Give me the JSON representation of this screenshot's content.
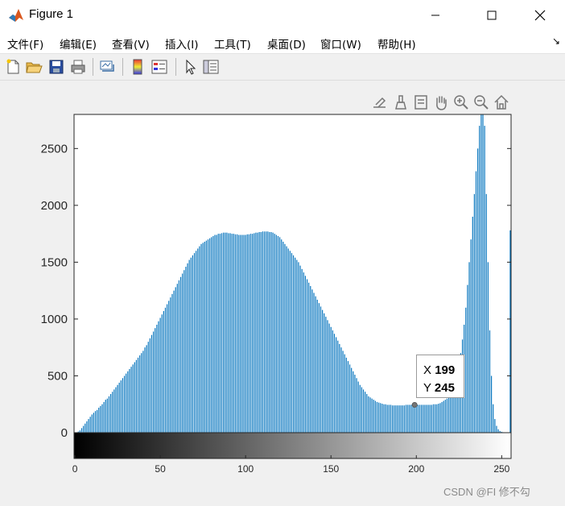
{
  "window": {
    "title": "Figure 1",
    "minimize_icon": "minimize-icon",
    "maximize_icon": "maximize-icon",
    "close_icon": "close-icon"
  },
  "menu": {
    "items": [
      "文件(F)",
      "编辑(E)",
      "查看(V)",
      "插入(I)",
      "工具(T)",
      "桌面(D)",
      "窗口(W)",
      "帮助(H)"
    ],
    "overflow_icon": "dock-arrow-icon"
  },
  "toolbar": {
    "buttons": [
      "new-figure-icon",
      "open-file-icon",
      "save-icon",
      "print-icon",
      "link-plot-icon",
      "insert-colorbar-icon",
      "insert-legend-icon",
      "edit-plot-arrow-icon",
      "property-inspector-icon"
    ]
  },
  "axes_toolbar": {
    "buttons": [
      "export-icon",
      "brush-icon",
      "data-tips-icon",
      "pan-hand-icon",
      "zoom-in-icon",
      "zoom-out-icon",
      "restore-view-home-icon"
    ]
  },
  "datatip": {
    "x_label": "X",
    "x_value": "199",
    "y_label": "Y",
    "y_value": "245"
  },
  "watermark": "CSDN @FI 修不勾",
  "chart_data": {
    "type": "bar",
    "title": "",
    "xlabel": "",
    "ylabel": "",
    "xlim": [
      0,
      255
    ],
    "ylim": [
      0,
      2800
    ],
    "yticks": [
      0,
      500,
      1000,
      1500,
      2000,
      2500
    ],
    "xticks": [
      0,
      50,
      100,
      150,
      200,
      250
    ],
    "bar_color": "#0072bd",
    "colorbar": "grayscale",
    "x": [
      0,
      1,
      2,
      3,
      4,
      5,
      6,
      7,
      8,
      9,
      10,
      11,
      12,
      13,
      14,
      15,
      16,
      17,
      18,
      19,
      20,
      21,
      22,
      23,
      24,
      25,
      26,
      27,
      28,
      29,
      30,
      31,
      32,
      33,
      34,
      35,
      36,
      37,
      38,
      39,
      40,
      41,
      42,
      43,
      44,
      45,
      46,
      47,
      48,
      49,
      50,
      51,
      52,
      53,
      54,
      55,
      56,
      57,
      58,
      59,
      60,
      61,
      62,
      63,
      64,
      65,
      66,
      67,
      68,
      69,
      70,
      71,
      72,
      73,
      74,
      75,
      76,
      77,
      78,
      79,
      80,
      81,
      82,
      83,
      84,
      85,
      86,
      87,
      88,
      89,
      90,
      91,
      92,
      93,
      94,
      95,
      96,
      97,
      98,
      99,
      100,
      101,
      102,
      103,
      104,
      105,
      106,
      107,
      108,
      109,
      110,
      111,
      112,
      113,
      114,
      115,
      116,
      117,
      118,
      119,
      120,
      121,
      122,
      123,
      124,
      125,
      126,
      127,
      128,
      129,
      130,
      131,
      132,
      133,
      134,
      135,
      136,
      137,
      138,
      139,
      140,
      141,
      142,
      143,
      144,
      145,
      146,
      147,
      148,
      149,
      150,
      151,
      152,
      153,
      154,
      155,
      156,
      157,
      158,
      159,
      160,
      161,
      162,
      163,
      164,
      165,
      166,
      167,
      168,
      169,
      170,
      171,
      172,
      173,
      174,
      175,
      176,
      177,
      178,
      179,
      180,
      181,
      182,
      183,
      184,
      185,
      186,
      187,
      188,
      189,
      190,
      191,
      192,
      193,
      194,
      195,
      196,
      197,
      198,
      199,
      200,
      201,
      202,
      203,
      204,
      205,
      206,
      207,
      208,
      209,
      210,
      211,
      212,
      213,
      214,
      215,
      216,
      217,
      218,
      219,
      220,
      221,
      222,
      223,
      224,
      225,
      226,
      227,
      228,
      229,
      230,
      231,
      232,
      233,
      234,
      235,
      236,
      237,
      238,
      239,
      240,
      241,
      242,
      243,
      244,
      245,
      246,
      247,
      248,
      249,
      250,
      251,
      252,
      253,
      254,
      255
    ],
    "values": [
      0,
      0,
      10,
      20,
      40,
      60,
      80,
      100,
      120,
      140,
      160,
      175,
      190,
      200,
      220,
      235,
      250,
      270,
      290,
      300,
      320,
      340,
      360,
      380,
      400,
      420,
      440,
      460,
      480,
      500,
      520,
      540,
      560,
      580,
      600,
      620,
      640,
      660,
      680,
      700,
      720,
      750,
      770,
      800,
      830,
      860,
      890,
      920,
      950,
      980,
      1010,
      1040,
      1070,
      1100,
      1130,
      1160,
      1190,
      1220,
      1250,
      1280,
      1310,
      1340,
      1370,
      1400,
      1430,
      1460,
      1490,
      1520,
      1540,
      1560,
      1580,
      1600,
      1620,
      1640,
      1660,
      1670,
      1680,
      1690,
      1700,
      1710,
      1720,
      1730,
      1740,
      1740,
      1750,
      1750,
      1755,
      1760,
      1760,
      1760,
      1755,
      1755,
      1750,
      1750,
      1745,
      1745,
      1740,
      1740,
      1740,
      1740,
      1740,
      1745,
      1745,
      1750,
      1750,
      1755,
      1760,
      1760,
      1765,
      1765,
      1770,
      1770,
      1770,
      1770,
      1765,
      1765,
      1760,
      1750,
      1740,
      1730,
      1720,
      1700,
      1680,
      1660,
      1640,
      1620,
      1600,
      1580,
      1560,
      1540,
      1520,
      1500,
      1470,
      1440,
      1410,
      1380,
      1350,
      1320,
      1290,
      1260,
      1230,
      1200,
      1170,
      1140,
      1110,
      1080,
      1050,
      1020,
      990,
      960,
      930,
      900,
      870,
      840,
      810,
      780,
      750,
      720,
      690,
      660,
      630,
      600,
      570,
      540,
      510,
      480,
      450,
      420,
      400,
      380,
      360,
      340,
      320,
      310,
      300,
      290,
      280,
      270,
      265,
      260,
      255,
      250,
      250,
      245,
      245,
      245,
      240,
      240,
      240,
      240,
      240,
      240,
      240,
      240,
      245,
      245,
      245,
      245,
      245,
      245,
      245,
      245,
      245,
      245,
      245,
      245,
      245,
      245,
      245,
      245,
      250,
      250,
      250,
      255,
      260,
      270,
      280,
      290,
      300,
      320,
      340,
      360,
      400,
      450,
      520,
      600,
      700,
      820,
      950,
      1100,
      1300,
      1500,
      1700,
      1900,
      2100,
      2300,
      2500,
      2700,
      2850,
      2900,
      2700,
      2100,
      1500,
      900,
      500,
      250,
      120,
      60,
      30,
      15,
      8,
      4,
      2,
      1,
      0,
      1780
    ]
  }
}
